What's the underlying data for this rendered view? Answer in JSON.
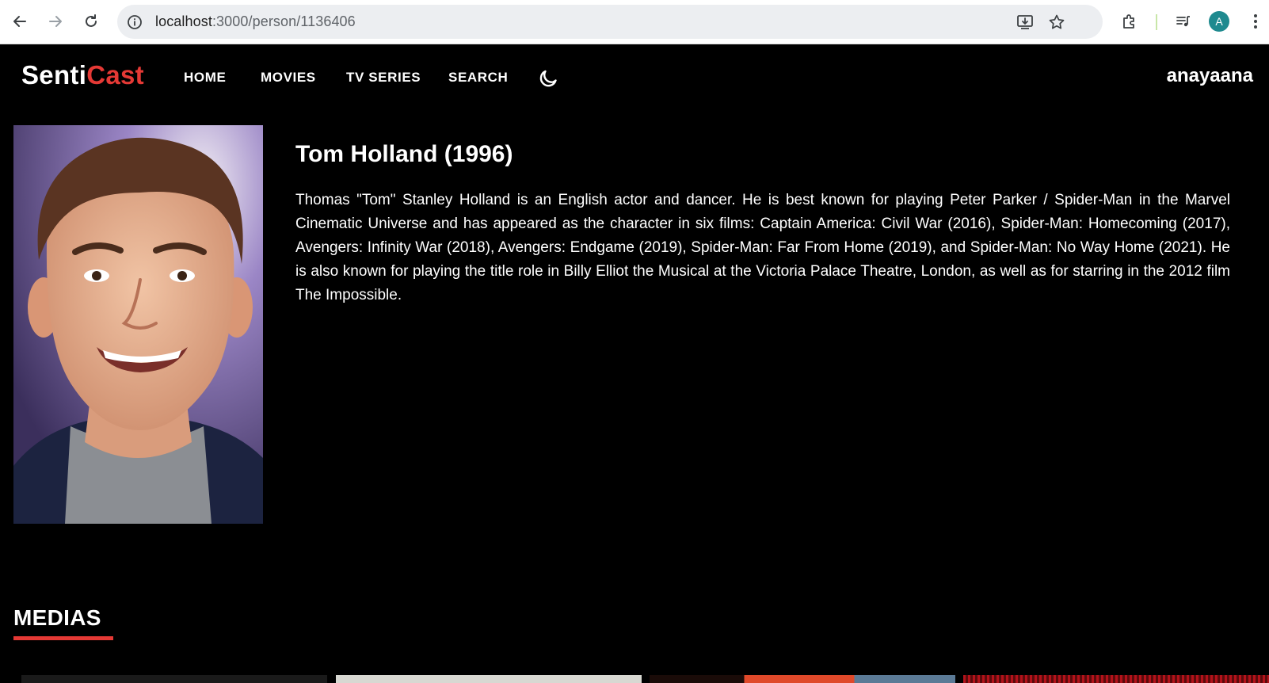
{
  "browser": {
    "url_host": "localhost",
    "url_path": ":3000/person/1136406",
    "profile_initial": "A"
  },
  "site": {
    "logo_part1": "Senti",
    "logo_part2": "Cast",
    "nav": [
      "HOME",
      "MOVIES",
      "TV SERIES",
      "SEARCH"
    ],
    "username": "anayaana",
    "accent": "#e53935"
  },
  "person": {
    "title": "Tom Holland (1996)",
    "bio": "Thomas \"Tom\" Stanley Holland is an English actor and dancer. He is best known for playing Peter Parker / Spider-Man in the Marvel Cinematic Universe and has appeared as the character in six films: Captain America: Civil War (2016), Spider-Man: Homecoming (2017), Avengers: Infinity War (2018), Avengers: Endgame (2019), Spider-Man: Far From Home (2019), and Spider-Man: No Way Home (2021). He is also known for playing the title role in Billy Elliot the Musical at the Victoria Palace Theatre, London, as well as for starring in the 2012 film The Impossible."
  },
  "medias": {
    "heading": "MEDIAS"
  },
  "icons": {
    "back": "back-arrow-icon",
    "forward": "forward-arrow-icon",
    "reload": "reload-icon",
    "site_info": "site-info-icon",
    "install": "install-app-icon",
    "bookmark": "bookmark-star-icon",
    "extensions": "extensions-puzzle-icon",
    "media_controls": "media-controls-icon",
    "menu": "kebab-menu-icon",
    "theme": "moon-icon"
  }
}
